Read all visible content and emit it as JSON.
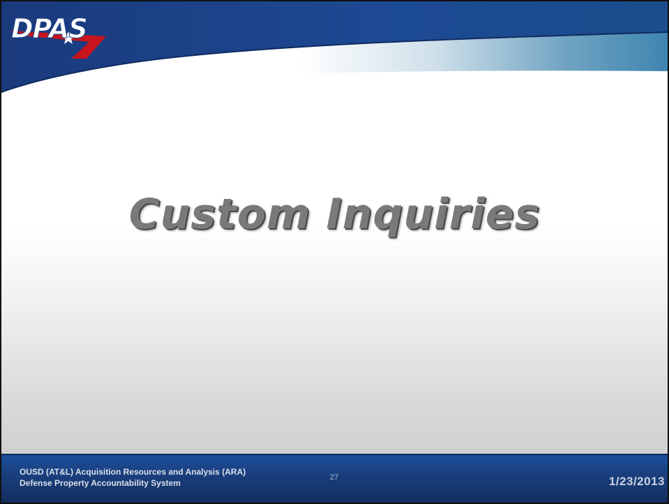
{
  "logo": {
    "text": "DPAS"
  },
  "slide": {
    "title": "Custom Inquiries"
  },
  "footer": {
    "org_line1": "OUSD (AT&L) Acquisition Resources and Analysis (ARA)",
    "org_line2": "Defense Property Accountability System",
    "page_number": "27",
    "date": "1/23/2013"
  },
  "colors": {
    "header_blue": "#1b3f86",
    "footer_blue": "#1a3f7e",
    "logo_red": "#c8141e",
    "title_gray": "#7a7a7a"
  }
}
